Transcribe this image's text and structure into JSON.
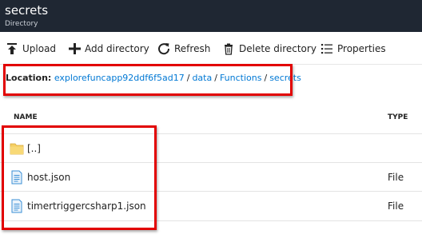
{
  "header": {
    "title": "secrets",
    "subtitle": "Directory"
  },
  "toolbar": {
    "upload": "Upload",
    "add_directory": "Add directory",
    "refresh": "Refresh",
    "delete_directory": "Delete directory",
    "properties": "Properties"
  },
  "location": {
    "label": "Location:",
    "separator": "/",
    "path": [
      "explorefuncapp92ddf6f5ad17",
      "data",
      "Functions",
      "secrets"
    ]
  },
  "table": {
    "columns": [
      "NAME",
      "TYPE"
    ],
    "rows": [
      {
        "name": "[..]",
        "type": "",
        "icon": "folder-icon"
      },
      {
        "name": "host.json",
        "type": "File",
        "icon": "file-icon"
      },
      {
        "name": "timertriggercsharp1.json",
        "type": "File",
        "icon": "file-icon"
      }
    ]
  },
  "colors": {
    "header_bg": "#1f2733",
    "link": "#0078d4",
    "highlight": "#e20000",
    "folder": "#f5cf63",
    "file": "#3a8fd6"
  }
}
